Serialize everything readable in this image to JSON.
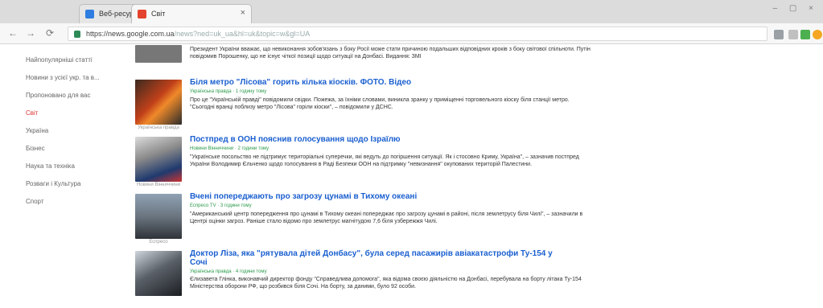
{
  "browser": {
    "tabs": [
      {
        "label": "Веб-ресурсы – Google Диск",
        "close": "×",
        "favicon_color": "#2f7de1"
      },
      {
        "label": "Світ",
        "close": "×",
        "favicon_color": "#e4432d"
      }
    ],
    "window_controls": "– ▢ ×",
    "nav": {
      "back": "←",
      "forward": "→",
      "reload": "⟳"
    },
    "url_host": "https://news.google.com.ua",
    "url_path": "/news?ned=uk_ua&hl=uk&topic=w&gl=UA"
  },
  "sidebar": {
    "items": [
      "Найпопулярніші статті",
      "Новини з усієї укр. та в...",
      "Пропоновано для вас",
      "Світ",
      "Україна",
      "Бізнес",
      "Наука та техніка",
      "Розваги і Культура",
      "Спорт"
    ],
    "active_index": 3
  },
  "stories": [
    {
      "headline": "",
      "meta": "",
      "snippet": "Президент України вважає, що невиконання зобов'язань з боку Росії може стати причиною подальших відповідних кроків з боку світової спільноти. Путін повідомив Порошенку, що не існує чіткої позиції щодо ситуації на Донбасі. Видання: ЗМІ",
      "caption": ""
    },
    {
      "headline": "Біля метро \"Лісова\" горить кілька кіосків. ФОТО. Відео",
      "meta": "Українська правда · 1 годину тому",
      "snippet": "Про це \"Українській правді\" повідомили свідки. Пожежа, за їхніми словами, виникла зранку у приміщенні торговельного кіоску біля станції метро. \"Сьогодні вранці поблизу метро \"Лісова\" горіли кіоски\", – повідомили у ДСНС.",
      "caption": "Українська правда"
    },
    {
      "headline": "Постпред в ООН пояснив голосування щодо Ізраїлю",
      "meta": "Новини Вінниччини · 2 години тому",
      "snippet": "\"Українське посольство не підтримує територіальні суперечки, які ведуть до погіршення ситуації. Як і стосовно Криму, Україна\", – зазначив постпред України Володимир Єльченко щодо голосування в Раді Безпеки ООН на підтримку \"невизнання\" окупованих територій Палестини.",
      "caption": "Новини Вінниччини"
    },
    {
      "headline": "Вчені попереджають про загрозу цунамі в Тихому океані",
      "meta": "Еспресо TV · 3 години тому",
      "snippet": "\"Американський центр попередження про цунамі в Тихому океані попереджає про загрозу цунамі в районі, після землетрусу біля Чилі\", – зазначили в Центрі оцінки загроз. Раніше стало відомо про землетрус магнітудою 7,6 біля узбережжя Чилі.",
      "caption": "Еспресо"
    },
    {
      "headline": "Доктор Ліза, яка \"рятувала дітей Донбасу\", була серед пасажирів авіакатастрофи Ту-154 у Сочі",
      "meta": "Українська правда · 4 години тому",
      "snippet": "Єлизавета Глінка, виконавчий директор фонду \"Справедлива допомога\", яка відома своєю діяльністю на Донбасі, перебувала на борту літака Ту-154 Міністерства оборони РФ, що розбився біля Сочі. На борту, за даними, було 92 особи.",
      "caption": "Українська правда"
    }
  ],
  "colors": {
    "headline": "#1a5fd0",
    "meta": "#2a9a4a",
    "sidebar_active": "#d33333"
  }
}
